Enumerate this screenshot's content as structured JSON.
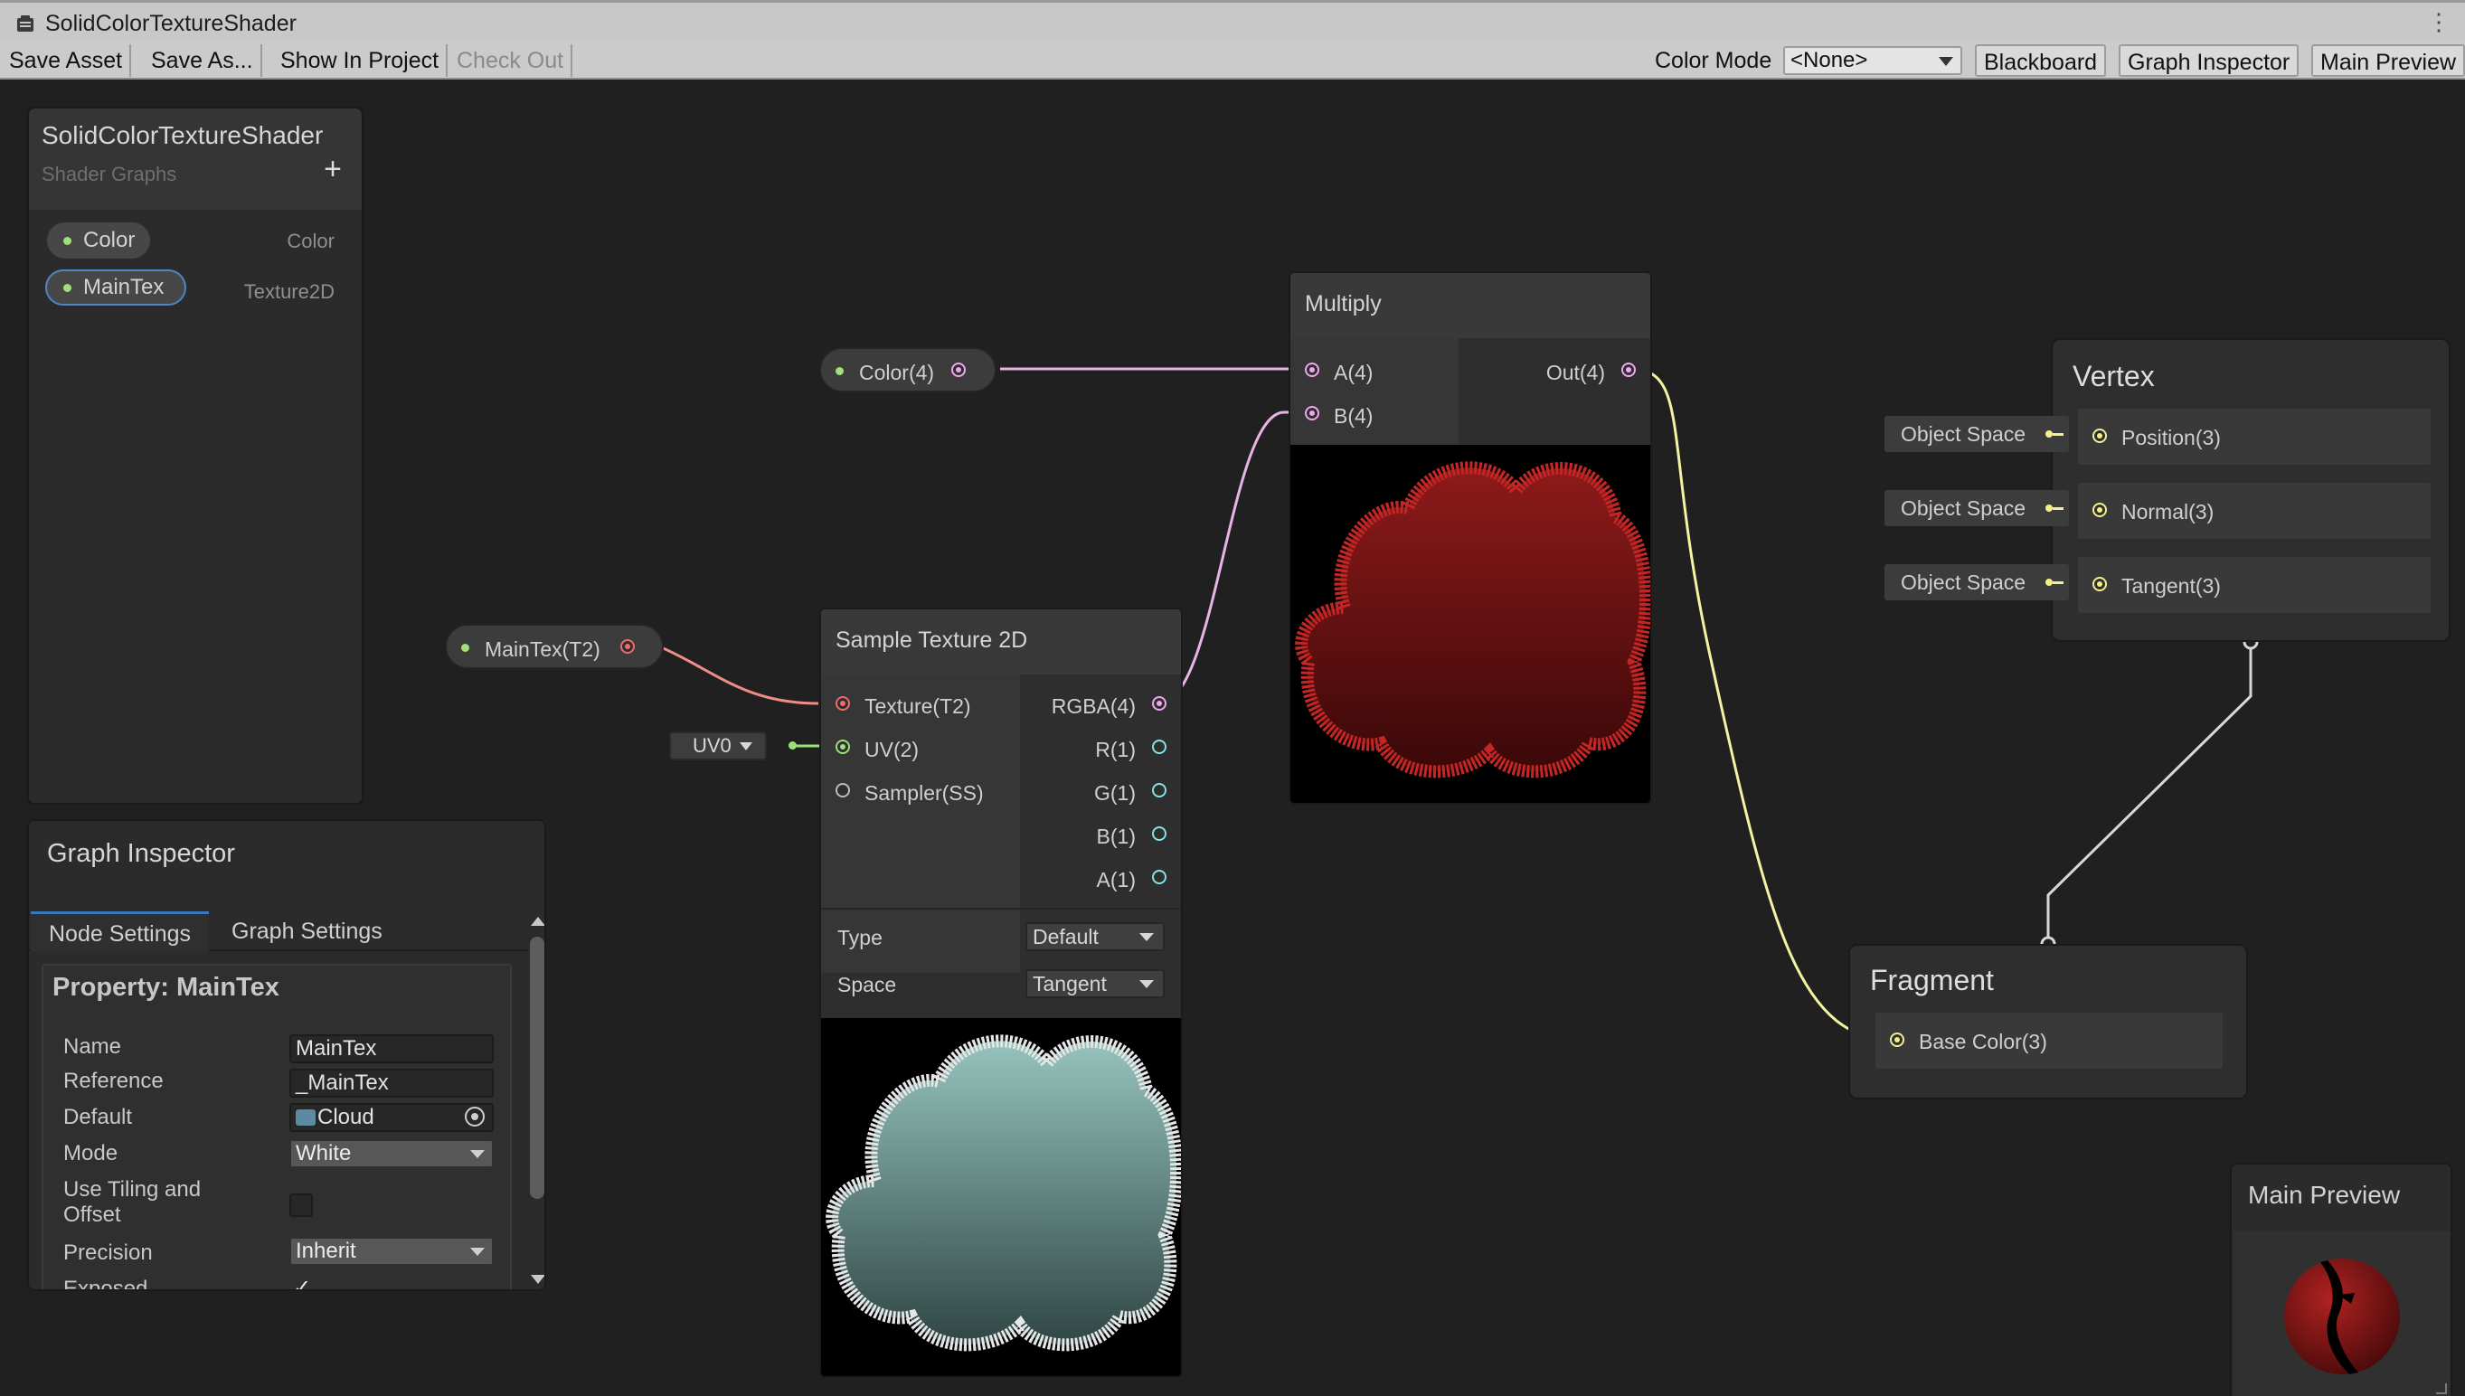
{
  "window": {
    "title": "SolidColorTextureShader"
  },
  "toolbar": {
    "save_asset": "Save Asset",
    "save_as": "Save As...",
    "show_in_project": "Show In Project",
    "check_out": "Check Out",
    "color_mode_label": "Color Mode",
    "color_mode_value": "<None>",
    "blackboard": "Blackboard",
    "graph_inspector": "Graph Inspector",
    "main_preview": "Main Preview"
  },
  "blackboard": {
    "title": "SolidColorTextureShader",
    "subtitle": "Shader Graphs",
    "add_icon": "plus-icon",
    "properties": [
      {
        "name": "Color",
        "type": "Color"
      },
      {
        "name": "MainTex",
        "type": "Texture2D"
      }
    ]
  },
  "inspector": {
    "title": "Graph Inspector",
    "tabs": [
      "Node Settings",
      "Graph Settings"
    ],
    "property_title": "Property: MainTex",
    "fields": {
      "name_label": "Name",
      "name_value": "MainTex",
      "reference_label": "Reference",
      "reference_value": "_MainTex",
      "default_label": "Default",
      "default_value": "Cloud",
      "mode_label": "Mode",
      "mode_value": "White",
      "tiling_label": "Use Tiling and Offset",
      "precision_label": "Precision",
      "precision_value": "Inherit",
      "exposed_label": "Exposed",
      "exposed_check": "✓"
    }
  },
  "nodes": {
    "color_prop": {
      "label": "Color(4)"
    },
    "maintex_prop": {
      "label": "MainTex(T2)"
    },
    "uv_select": "UV0",
    "sample_texture": {
      "title": "Sample Texture 2D",
      "inputs": [
        "Texture(T2)",
        "UV(2)",
        "Sampler(SS)"
      ],
      "outputs": [
        "RGBA(4)",
        "R(1)",
        "G(1)",
        "B(1)",
        "A(1)"
      ],
      "type_label": "Type",
      "type_value": "Default",
      "space_label": "Space",
      "space_value": "Tangent"
    },
    "multiply": {
      "title": "Multiply",
      "inputs": [
        "A(4)",
        "B(4)"
      ],
      "output": "Out(4)"
    },
    "vertex": {
      "title": "Vertex",
      "rows": [
        {
          "space": "Object Space",
          "label": "Position(3)"
        },
        {
          "space": "Object Space",
          "label": "Normal(3)"
        },
        {
          "space": "Object Space",
          "label": "Tangent(3)"
        }
      ]
    },
    "fragment": {
      "title": "Fragment",
      "rows": [
        {
          "label": "Base Color(3)"
        }
      ]
    }
  },
  "main_preview": {
    "title": "Main Preview"
  },
  "colors": {
    "canvas": "#202020",
    "wire_vector4": "#e8b4e6",
    "wire_texture": "#f08c88",
    "wire_vector2": "#9fe07a",
    "wire_vector3": "#f3f3a2",
    "wire_master": "#d8d8d8",
    "port_texture": "#f06b6b",
    "port_vector4": "#f0a6f0",
    "port_vector1": "#84e4e7",
    "port_vector2": "#9fe07a",
    "port_vector3": "#f6f08c",
    "selection": "#4f86c6",
    "red_preview": "#8e1a1a",
    "teal_preview": "#8db7b3"
  }
}
